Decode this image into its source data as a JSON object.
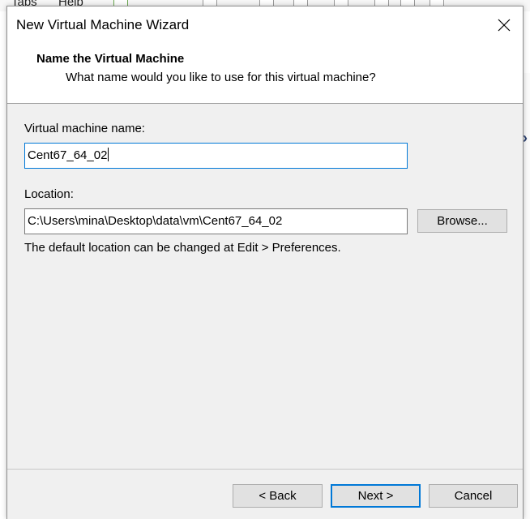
{
  "background_app": {
    "menu_items": [
      "Tabs",
      "Help"
    ]
  },
  "dialog": {
    "title": "New Virtual Machine Wizard",
    "header": {
      "title": "Name the Virtual Machine",
      "subtitle": "What name would you like to use for this virtual machine?"
    },
    "vm_name": {
      "label": "Virtual machine name:",
      "value": "Cent67_64_02"
    },
    "location": {
      "label": "Location:",
      "value": "C:\\Users\\mina\\Desktop\\data\\vm\\Cent67_64_02",
      "browse_label": "Browse..."
    },
    "hint": "The default location can be changed at Edit > Preferences.",
    "buttons": {
      "back": "< Back",
      "next": "Next >",
      "cancel": "Cancel"
    }
  },
  "colors": {
    "focus": "#0078d7",
    "dialog_bg": "#f0f0f0",
    "button_bg": "#e1e1e1"
  }
}
